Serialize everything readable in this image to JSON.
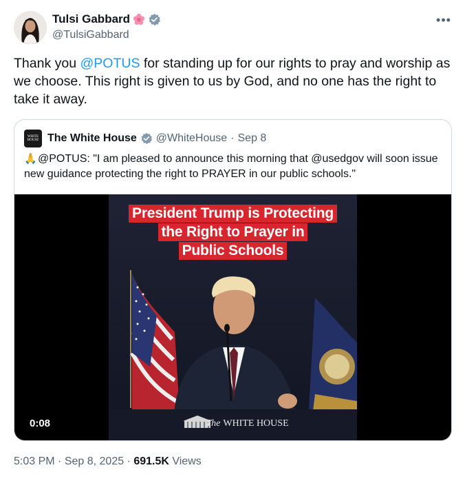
{
  "author": {
    "name": "Tulsi Gabbard",
    "handle": "@TulsiGabbard",
    "badge_icon": "hibiscus-flower-icon",
    "verified_icon": "verified-badge-icon",
    "verified_color": "#829aab"
  },
  "more_icon": "more-options-icon",
  "tweet": {
    "text_before": "Thank you ",
    "mention": "@POTUS",
    "text_after": " for standing up for our rights to pray and worship as we choose. This right is given to us by God, and no one has the right to take it away."
  },
  "quoted": {
    "avatar_text": [
      "WHITE",
      "HOUSE"
    ],
    "name": "The White House",
    "handle": "@WhiteHouse",
    "separator": "·",
    "date": "Sep 8",
    "prefix_icon": "praying-hands-icon",
    "prefix_glyph": "🙏",
    "text": "@POTUS: \"I am pleased to announce this morning that @usedgov will soon issue new guidance protecting the right to PRAYER in our public schools.\"",
    "video": {
      "headline_lines": [
        "President Trump is Protecting",
        "the Right to Prayer in",
        "Public Schools"
      ],
      "headline_color": "#d7262e",
      "duration": "0:08",
      "logo_prefix": "The",
      "logo_text": "WHITE HOUSE"
    }
  },
  "footer": {
    "time": "5:03 PM",
    "sep1": " · ",
    "date": "Sep 8, 2025",
    "sep2": " · ",
    "views_count": "691.5K",
    "views_label": " Views"
  }
}
